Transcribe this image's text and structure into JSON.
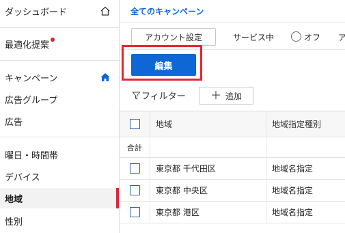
{
  "sidebar": {
    "items": [
      {
        "label": "ダッシュボード",
        "icon": "home-outline-icon"
      },
      {
        "label": "最適化提案",
        "badge": "red-dot"
      },
      {
        "label": "キャンペーン",
        "icon": "home-filled-icon"
      },
      {
        "label": "広告グループ"
      },
      {
        "label": "広告"
      },
      {
        "label": "曜日・時間帯"
      },
      {
        "label": "デバイス"
      },
      {
        "label": "地域",
        "active": true
      },
      {
        "label": "性別"
      }
    ]
  },
  "header": {
    "breadcrumb": "全てのキャンペーン"
  },
  "toolbar": {
    "account_settings_label": "アカウント設定",
    "service_label": "サービス中",
    "off_label": "オフ",
    "truncated_label": "ア",
    "edit_label": "編集",
    "filter_label": "フィルター",
    "add_label": "追加"
  },
  "table": {
    "columns": [
      "地域",
      "地域指定種別"
    ],
    "total_label": "合計",
    "rows": [
      {
        "region": "東京都 千代田区",
        "type": "地域名指定"
      },
      {
        "region": "東京都 中央区",
        "type": "地域名指定"
      },
      {
        "region": "東京都 港区",
        "type": "地域名指定"
      }
    ]
  },
  "colors": {
    "accent_blue": "#0e67d4",
    "link_blue": "#0c64d6",
    "highlight_red": "#e8242f",
    "active_bar": "#d9283c"
  }
}
